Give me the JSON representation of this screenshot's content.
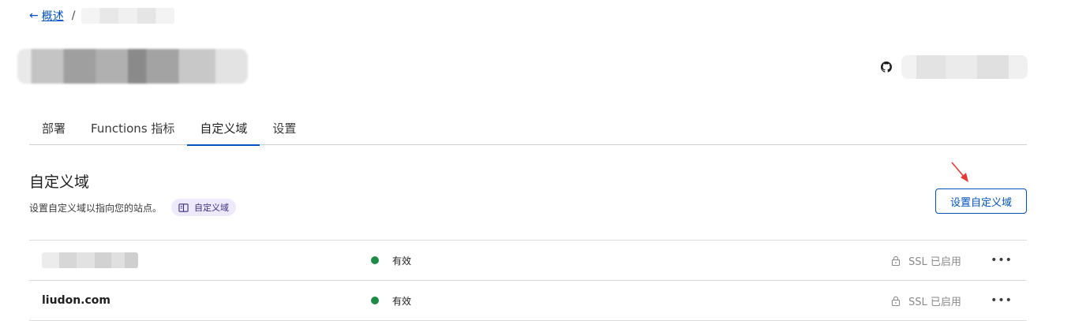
{
  "breadcrumb": {
    "back_label": "概述",
    "separator": "/"
  },
  "repo": {
    "icon": "github-icon"
  },
  "tabs": [
    {
      "label": "部署",
      "active": false
    },
    {
      "label": "Functions 指标",
      "active": false
    },
    {
      "label": "自定义域",
      "active": true
    },
    {
      "label": "设置",
      "active": false
    }
  ],
  "section": {
    "title": "自定义域",
    "description": "设置自定义域以指向您的站点。",
    "doc_badge_label": "自定义域",
    "doc_badge_icon": "book-icon",
    "action_label": "设置自定义域"
  },
  "domains": [
    {
      "name": "",
      "name_blurred": true,
      "status": "有效",
      "ssl": "SSL 已启用"
    },
    {
      "name": "liudon.com",
      "name_blurred": false,
      "status": "有效",
      "ssl": "SSL 已启用"
    }
  ],
  "colors": {
    "accent": "#0051c3",
    "status_active": "#1e8a46",
    "annotation": "#e53935"
  }
}
